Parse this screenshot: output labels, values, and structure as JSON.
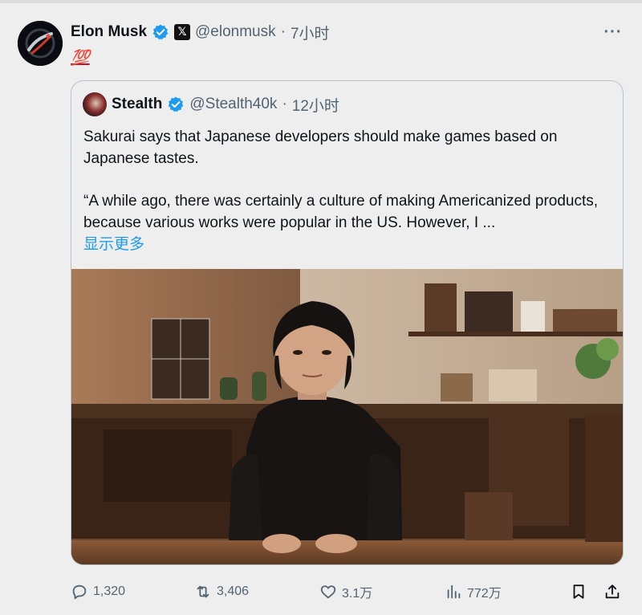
{
  "post": {
    "author": {
      "display_name": "Elon Musk",
      "handle": "@elonmusk",
      "affiliation_badge": "𝕏",
      "verified": true
    },
    "separator": "·",
    "timestamp": "7小时",
    "text": "💯",
    "more_label": "···"
  },
  "quote": {
    "author": {
      "display_name": "Stealth",
      "handle": "@Stealth40k",
      "verified": true
    },
    "separator": "·",
    "timestamp": "12小时",
    "paragraph_1": "Sakurai says that Japanese developers should make games based on Japanese tastes.",
    "paragraph_2": "“A while ago, there was certainly a culture of making Americanized products, because various works were popular in the US. However, I ...",
    "show_more": "显示更多"
  },
  "actions": {
    "replies": "1,320",
    "reposts": "3,406",
    "likes": "3.1万",
    "views": "772万"
  },
  "colors": {
    "background": "#eeeeee",
    "verified_blue": "#1d9bf0",
    "secondary_text": "#536471",
    "link": "#1d9bf0"
  },
  "icons": [
    "verified-icon",
    "x-affiliation-icon",
    "more-icon",
    "reply-icon",
    "repost-icon",
    "like-icon",
    "views-icon",
    "bookmark-icon",
    "share-icon"
  ]
}
